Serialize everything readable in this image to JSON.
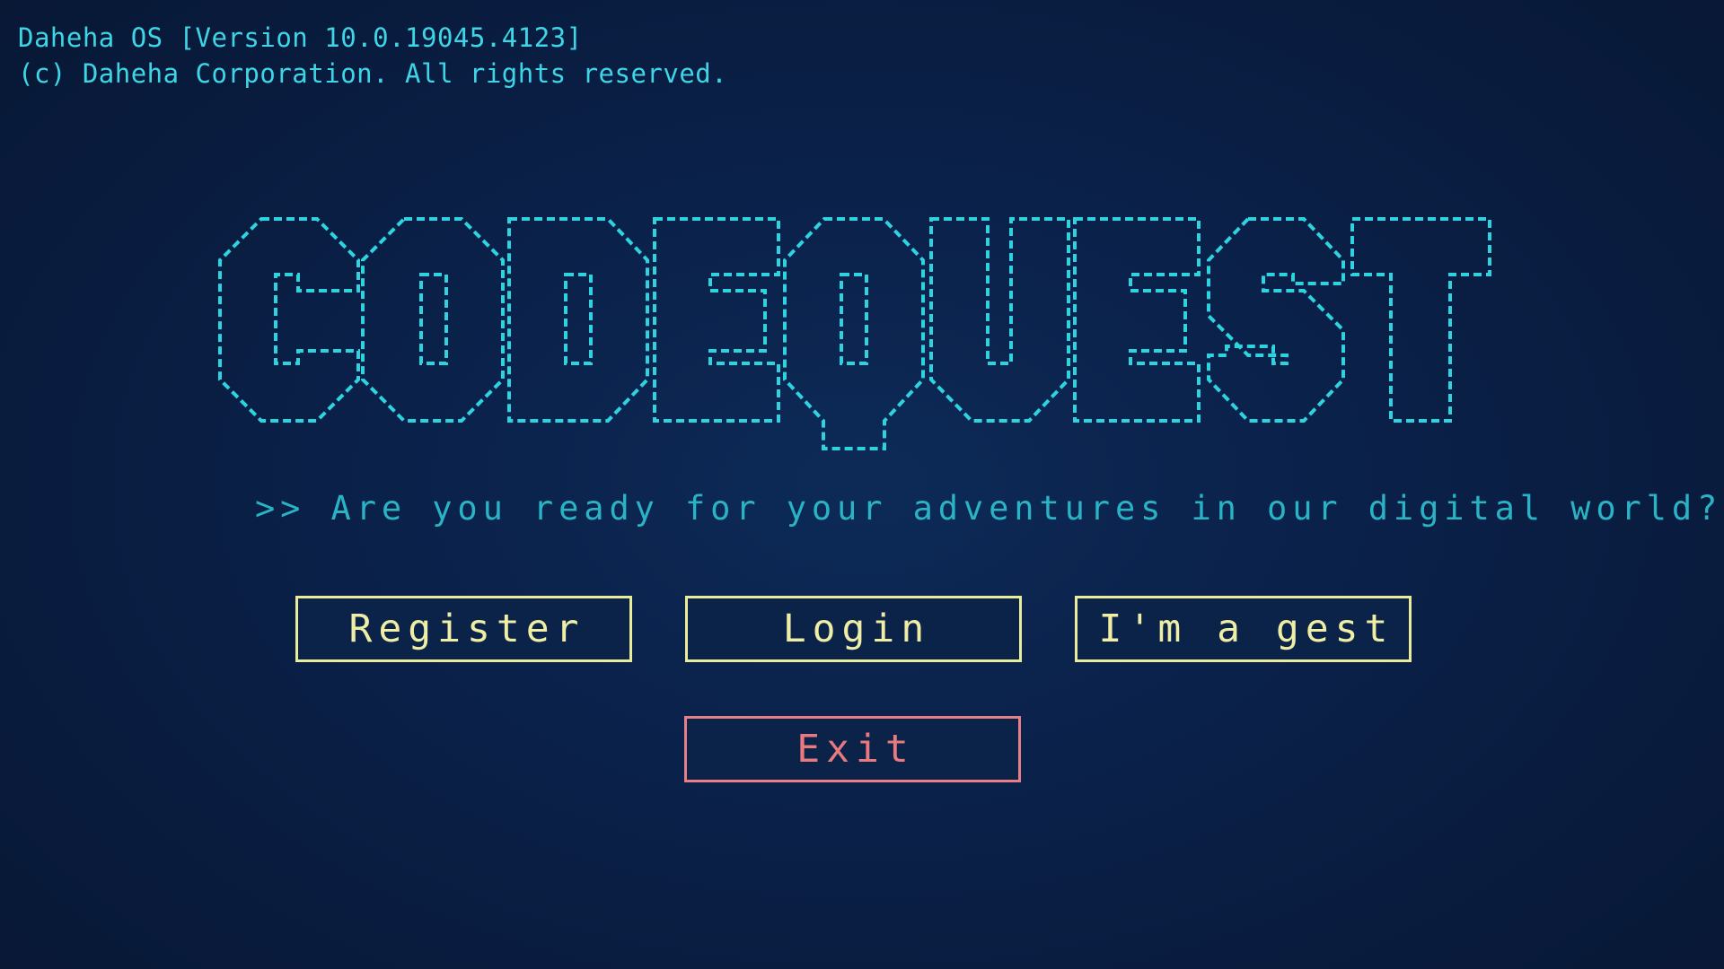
{
  "header": {
    "line1": "Daheha OS [Version 10.0.19045.4123]",
    "line2": "(c) Daheha Corporation. All rights reserved."
  },
  "logo": {
    "text": "CODEQUEST",
    "color": "#2fd3e0"
  },
  "tagline": ">> Are you ready for your adventures in our digital world?",
  "buttons": {
    "register": "Register",
    "login": "Login",
    "guest": "I'm a gest",
    "exit": "Exit"
  },
  "colors": {
    "background": "#0a2048",
    "header_text": "#3ed6e6",
    "button_border": "#e9ec9a",
    "exit_border": "#e87f86"
  }
}
